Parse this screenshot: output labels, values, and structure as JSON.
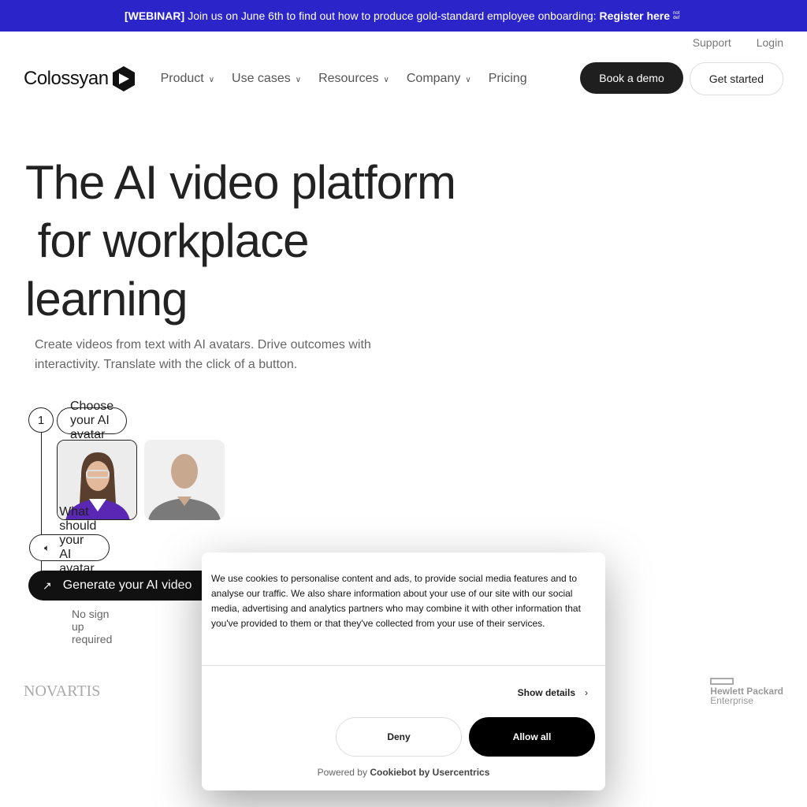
{
  "banner": {
    "tag": "[WEBINAR]",
    "text": "Join us on June 6th to find out how to produce gold-standard employee onboarding:",
    "link": "Register here",
    "sup": "not def"
  },
  "top_links": [
    "Support",
    "Login"
  ],
  "brand": "Colossyan",
  "nav": [
    "Product",
    "Use cases",
    "Resources",
    "Company",
    "Pricing"
  ],
  "buttons": {
    "demo": "Book a demo",
    "start": "Get started"
  },
  "hero": {
    "title_1": "The AI video platform",
    "title_2": " for workplace",
    "title_3": "learning",
    "subtitle": "Create videos from text with AI avatars. Drive outcomes with interactivity. Translate with the click of a button."
  },
  "steps": {
    "num": "1",
    "choose": "Choose your AI avatar",
    "say": "What should your AI avatar say?",
    "generate": "Generate your AI video",
    "note": "No sign up required"
  },
  "logos": [
    "NOVARTIS",
    "Hewlett Packard",
    "Enterprise"
  ],
  "cookie": {
    "text": "We use cookies to personalise content and ads, to provide social media features and to analyse our traffic. We also share information about your use of our site with our social media, advertising and analytics partners who may combine it with other information that you've provided to them or that they've collected from your use of their services.",
    "show_details": "Show details",
    "deny": "Deny",
    "allow": "Allow all",
    "powered": "Powered by",
    "powered_brand": "Cookiebot by Usercentrics"
  },
  "colors": {
    "banner": "#2b24c8",
    "accent_dark": "#1f1f1f"
  }
}
